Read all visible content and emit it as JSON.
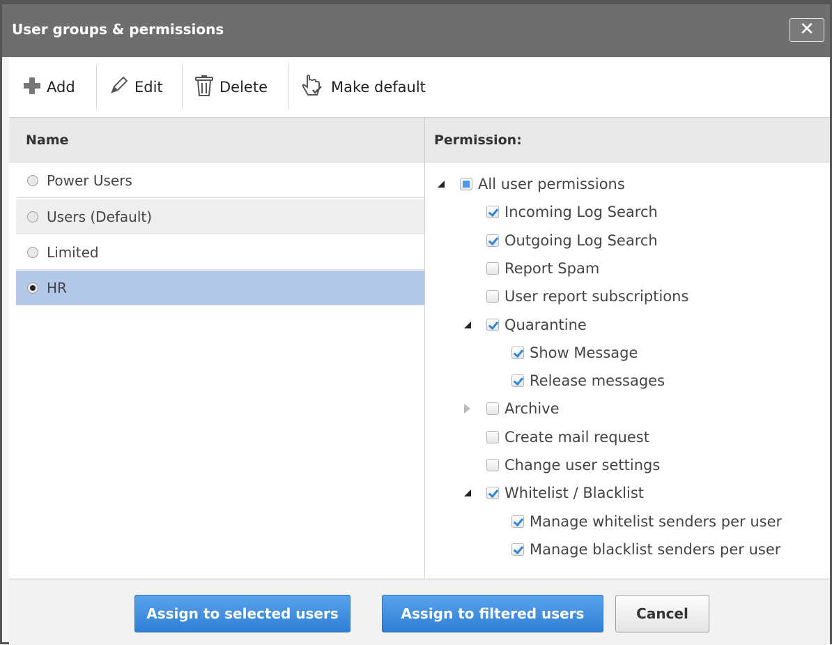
{
  "dialog": {
    "title": "User groups & permissions",
    "close_label": "✕"
  },
  "toolbar": {
    "add_label": "Add",
    "edit_label": "Edit",
    "delete_label": "Delete",
    "make_default_label": "Make default"
  },
  "groups": {
    "header": "Name",
    "items": [
      {
        "label": "Power Users",
        "selected": false
      },
      {
        "label": "Users (Default)",
        "selected": false
      },
      {
        "label": "Limited",
        "selected": false
      },
      {
        "label": "HR",
        "selected": true
      }
    ]
  },
  "permissions": {
    "header": "Permission:",
    "tree": [
      {
        "label": "All user permissions",
        "state": "partial",
        "expander": "open"
      },
      {
        "label": "Incoming Log Search",
        "state": "checked"
      },
      {
        "label": "Outgoing Log Search",
        "state": "checked"
      },
      {
        "label": "Report Spam",
        "state": "unchecked"
      },
      {
        "label": "User report subscriptions",
        "state": "unchecked"
      },
      {
        "label": "Quarantine",
        "state": "checked",
        "expander": "open"
      },
      {
        "label": "Show Message",
        "state": "checked"
      },
      {
        "label": "Release messages",
        "state": "checked"
      },
      {
        "label": "Archive",
        "state": "unchecked",
        "expander": "closed"
      },
      {
        "label": "Create mail request",
        "state": "unchecked"
      },
      {
        "label": "Change user settings",
        "state": "unchecked"
      },
      {
        "label": "Whitelist / Blacklist",
        "state": "checked",
        "expander": "open"
      },
      {
        "label": "Manage whitelist senders per user",
        "state": "checked"
      },
      {
        "label": "Manage blacklist senders per user",
        "state": "checked"
      }
    ]
  },
  "footer": {
    "assign_selected_label": "Assign to selected users",
    "assign_filtered_label": "Assign to filtered users",
    "cancel_label": "Cancel"
  },
  "colors": {
    "selection": "#b4c8e9",
    "primary_button": "#3a8ae0",
    "titlebar": "#6e6e6e"
  }
}
